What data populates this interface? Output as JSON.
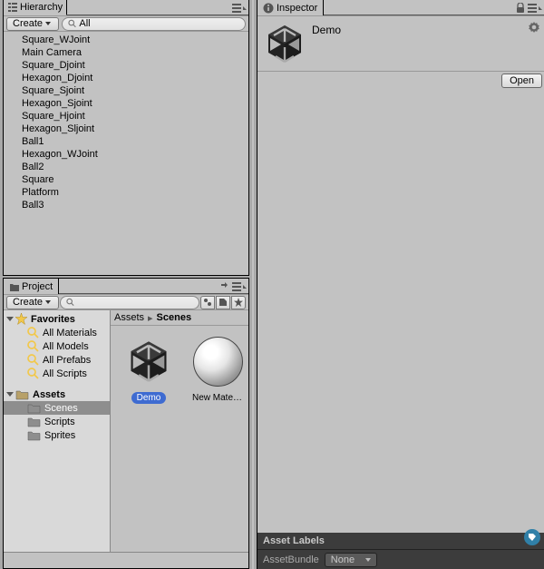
{
  "hierarchy": {
    "tab_label": "Hierarchy",
    "create_label": "Create",
    "search_value": "All",
    "items": [
      {
        "name": "Square_WJoint"
      },
      {
        "name": "Main Camera"
      },
      {
        "name": "Square_Djoint"
      },
      {
        "name": "Hexagon_Djoint"
      },
      {
        "name": "Square_Sjoint"
      },
      {
        "name": "Hexagon_Sjoint"
      },
      {
        "name": "Square_Hjoint"
      },
      {
        "name": "Hexagon_Sljoint"
      },
      {
        "name": "Ball1"
      },
      {
        "name": "Hexagon_WJoint"
      },
      {
        "name": "Ball2"
      },
      {
        "name": "Square"
      },
      {
        "name": "Platform"
      },
      {
        "name": "Ball3"
      }
    ]
  },
  "project": {
    "tab_label": "Project",
    "create_label": "Create",
    "search_value": "",
    "favorites_label": "Favorites",
    "favorites": [
      {
        "name": "All Materials"
      },
      {
        "name": "All Models"
      },
      {
        "name": "All Prefabs"
      },
      {
        "name": "All Scripts"
      }
    ],
    "assets_label": "Assets",
    "folders": [
      {
        "name": "Scenes",
        "selected": true
      },
      {
        "name": "Scripts",
        "selected": false
      },
      {
        "name": "Sprites",
        "selected": false
      }
    ],
    "breadcrumb": [
      {
        "name": "Assets"
      },
      {
        "name": "Scenes"
      }
    ],
    "grid_items": [
      {
        "name": "Demo",
        "type": "scene",
        "selected": true
      },
      {
        "name": "New Materi...",
        "type": "material",
        "selected": false
      }
    ]
  },
  "inspector": {
    "tab_label": "Inspector",
    "asset_name": "Demo",
    "open_label": "Open",
    "asset_labels_label": "Asset Labels",
    "asset_bundle_label": "AssetBundle",
    "asset_bundle_value": "None"
  }
}
